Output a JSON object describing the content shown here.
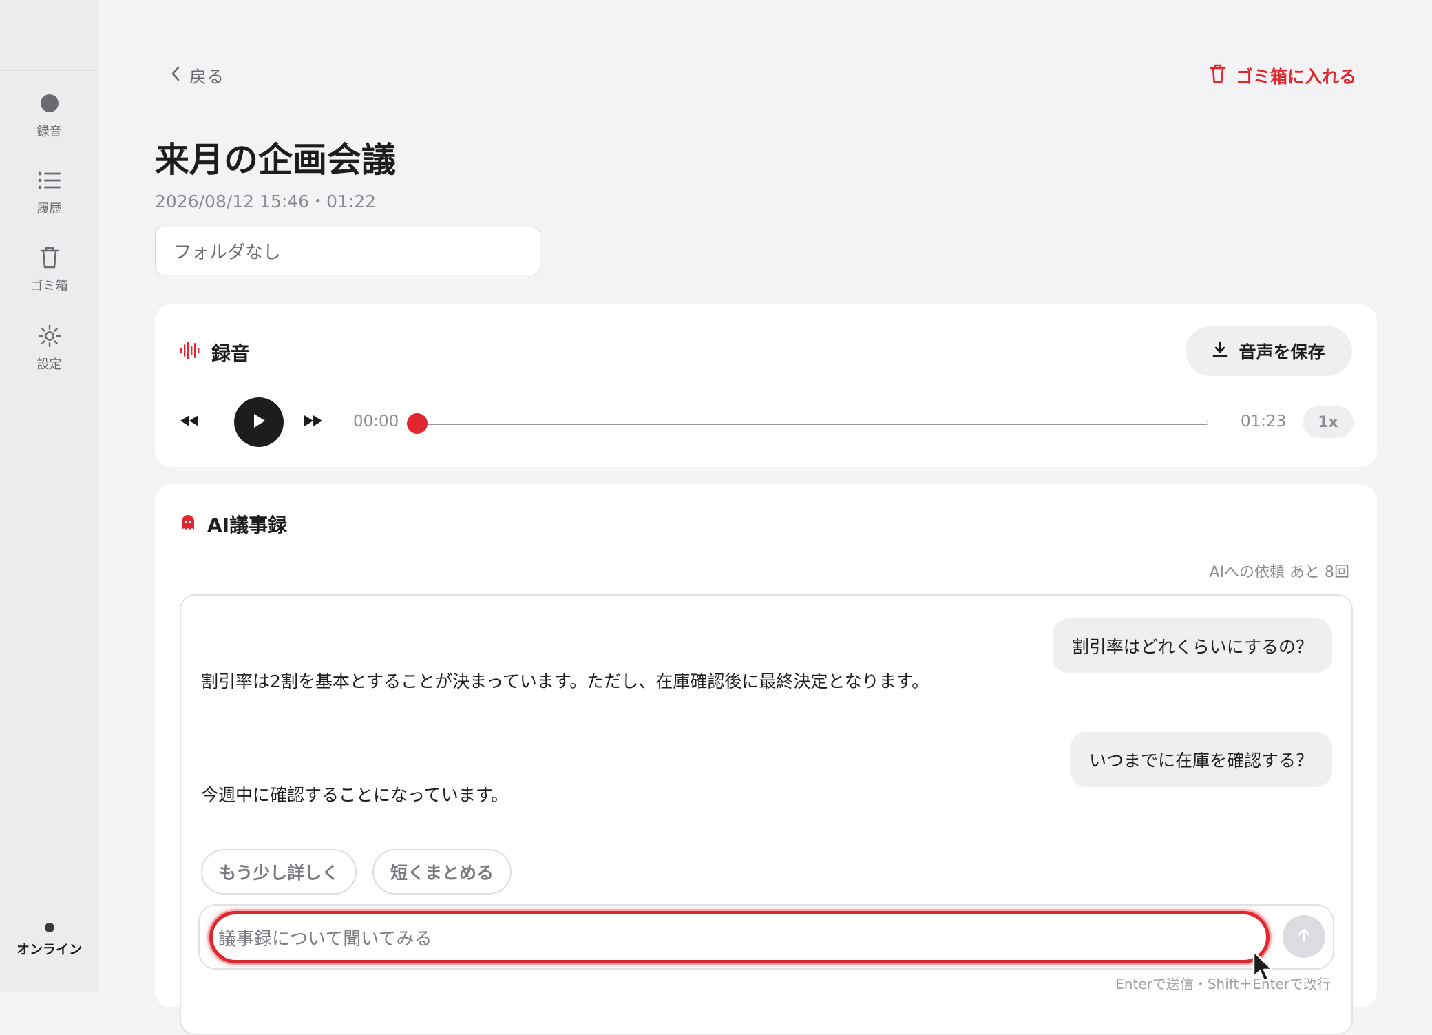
{
  "sidebar": {
    "items": [
      {
        "label": "録音",
        "icon": "record-dot-icon"
      },
      {
        "label": "履歴",
        "icon": "list-icon"
      },
      {
        "label": "ゴミ箱",
        "icon": "trash-icon"
      },
      {
        "label": "設定",
        "icon": "gear-icon"
      }
    ],
    "status": "オンライン"
  },
  "header": {
    "back_label": "戻る",
    "trash_label": "ゴミ箱に入れる"
  },
  "meeting": {
    "title": "来月の企画会議",
    "meta": "2026/08/12 15:46・01:22",
    "folder": "フォルダなし"
  },
  "recording": {
    "title": "録音",
    "save_label": "音声を保存",
    "current_time": "00:00",
    "total_time": "01:23",
    "progress": 0.0,
    "speed": "1x"
  },
  "ai": {
    "title": "AI議事録",
    "quota": "AIへの依頼 あと 8回",
    "messages": [
      {
        "role": "user",
        "text": "割引率はどれくらいにするの？"
      },
      {
        "role": "ai",
        "text": "割引率は2割を基本とすることが決まっています。ただし、在庫確認後に最終決定となります。"
      },
      {
        "role": "user",
        "text": "いつまでに在庫を確認する？"
      },
      {
        "role": "ai",
        "text": "今週中に確認することになっています。"
      }
    ],
    "suggestions": [
      "もう少し詳しく",
      "短くまとめる"
    ],
    "input_placeholder": "議事録について聞いてみる",
    "hint": "Enterで送信・Shift＋Enterで改行"
  },
  "colors": {
    "accent": "#e0262f",
    "background": "#f3f3f5",
    "card": "#ffffff"
  }
}
